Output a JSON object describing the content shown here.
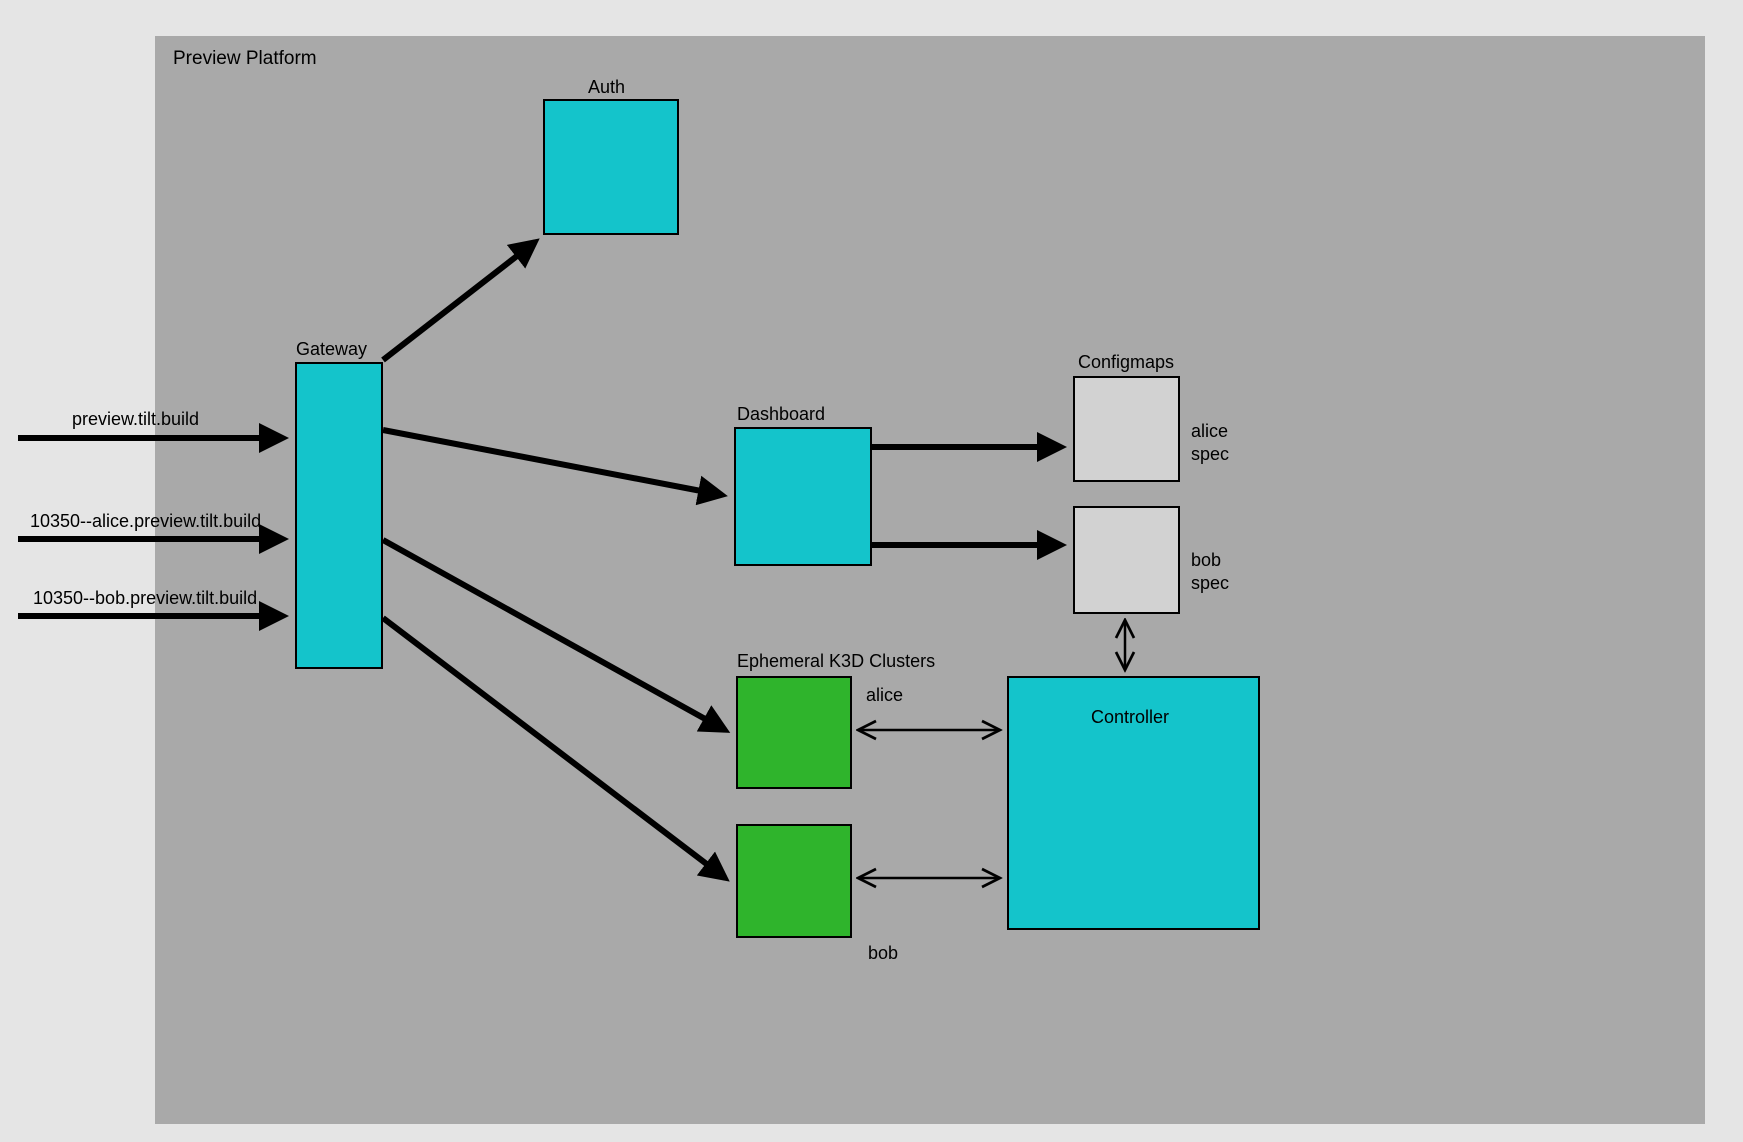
{
  "platform": {
    "title": "Preview Platform"
  },
  "inputs": [
    {
      "label": "preview.tilt.build"
    },
    {
      "label": "10350--alice.preview.tilt.build"
    },
    {
      "label": "10350--bob.preview.tilt.build"
    }
  ],
  "nodes": {
    "gateway": {
      "label": "Gateway",
      "color": "#14c4cb"
    },
    "auth": {
      "label": "Auth",
      "color": "#14c4cb"
    },
    "dashboard": {
      "label": "Dashboard",
      "color": "#14c4cb"
    },
    "controller": {
      "label": "Controller",
      "color": "#14c4cb"
    },
    "configmaps": {
      "label": "Configmaps",
      "items": [
        {
          "label": "alice\nspec"
        },
        {
          "label": "bob\nspec"
        }
      ],
      "color": "#d2d2d2"
    },
    "clusters": {
      "label": "Ephemeral K3D Clusters",
      "items": [
        {
          "label": "alice"
        },
        {
          "label": "bob"
        }
      ],
      "color": "#2fb42c"
    }
  },
  "arrows": [
    {
      "from": "input-0",
      "to": "gateway",
      "style": "thick-single"
    },
    {
      "from": "input-1",
      "to": "gateway",
      "style": "thick-single"
    },
    {
      "from": "input-2",
      "to": "gateway",
      "style": "thick-single"
    },
    {
      "from": "gateway",
      "to": "auth",
      "style": "thick-single"
    },
    {
      "from": "gateway",
      "to": "dashboard",
      "style": "thick-single"
    },
    {
      "from": "gateway",
      "to": "cluster-alice",
      "style": "thick-single"
    },
    {
      "from": "gateway",
      "to": "cluster-bob",
      "style": "thick-single"
    },
    {
      "from": "dashboard",
      "to": "configmap-alice",
      "style": "thick-single"
    },
    {
      "from": "dashboard",
      "to": "configmap-bob",
      "style": "thick-single"
    },
    {
      "from": "cluster-alice",
      "to": "controller",
      "style": "thin-double"
    },
    {
      "from": "cluster-bob",
      "to": "controller",
      "style": "thin-double"
    },
    {
      "from": "controller",
      "to": "configmap-bob",
      "style": "thin-double"
    }
  ]
}
